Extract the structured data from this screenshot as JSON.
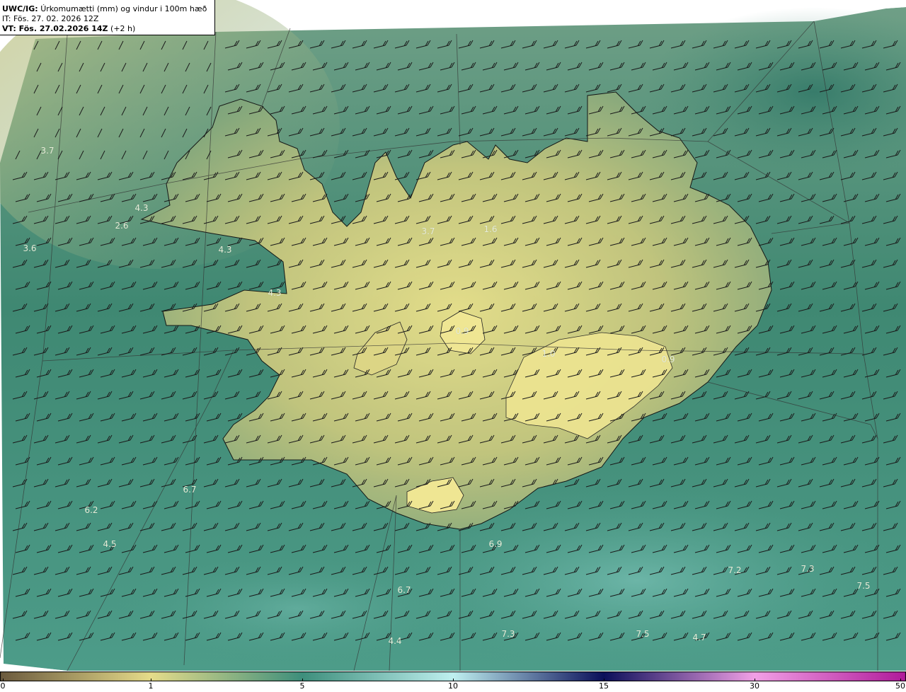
{
  "title": {
    "product": "UWC/IG:",
    "description": "Úrkomumætti (mm) og vindur i 100m hæð",
    "issue_time": "IT: Fös. 27. 02. 2026 12Z",
    "valid_prefix": "VT: Fös. 27.02.2026 14Z",
    "valid_suffix": "(+2 h)"
  },
  "colorbar": {
    "ticks": [
      "0",
      "1",
      "5",
      "10",
      "15",
      "30",
      "50"
    ],
    "colors": {
      "c0": "#6b5a3e",
      "c1": "#e6dc8a",
      "c5": "#3e8f7c",
      "c10": "#bff0f0",
      "c15": "#0b0f5a",
      "c30": "#f2a0e6",
      "c50": "#b01a9a"
    }
  },
  "map_labels": [
    {
      "text": "3.7"
    },
    {
      "text": "4.3"
    },
    {
      "text": "2.6"
    },
    {
      "text": "3.6"
    },
    {
      "text": "4.3"
    },
    {
      "text": "4.3"
    },
    {
      "text": "3.7"
    },
    {
      "text": "1.6"
    },
    {
      "text": "0.9"
    },
    {
      "text": "1.0"
    },
    {
      "text": "0.9"
    },
    {
      "text": "6.7"
    },
    {
      "text": "6.2"
    },
    {
      "text": "4.5"
    },
    {
      "text": "6.9"
    },
    {
      "text": "6.7"
    },
    {
      "text": "7.2"
    },
    {
      "text": "7.3"
    },
    {
      "text": "7.5"
    },
    {
      "text": "7.3"
    },
    {
      "text": "7.5"
    },
    {
      "text": "4.7"
    },
    {
      "text": "4.4"
    }
  ],
  "icons": {
    "wind": "wind-barb-icon"
  }
}
